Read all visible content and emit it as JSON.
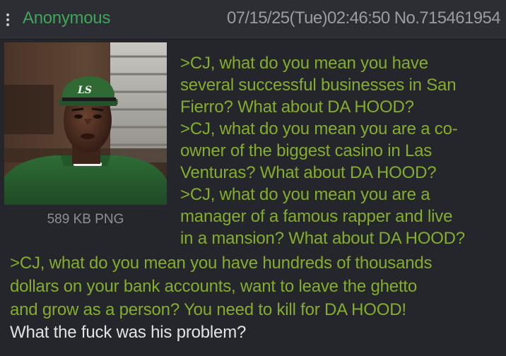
{
  "header": {
    "name": "Anonymous",
    "datetime": "07/15/25(Tue)02:46:50",
    "post_number": "No.715461954"
  },
  "file": {
    "info": "589 KB PNG",
    "cap_text": "LS"
  },
  "post": {
    "lines": [
      ">CJ, what do you mean you have",
      "several successful businesses in San",
      "Fierro? What about DA HOOD?",
      ">CJ, what do you mean you are a co-",
      "owner of the biggest casino in Las",
      "Venturas? What about DA HOOD?",
      ">CJ, what do you mean you are a",
      "manager of a famous rapper and live",
      "in a mansion? What about DA HOOD?",
      ">CJ, what do you mean you have hundreds of thousands",
      "dollars on your bank accounts, want to leave the ghetto",
      "and grow as a person? You need to kill for DA HOOD!",
      "What the fuck was his problem?"
    ]
  },
  "colors": {
    "background": "#25262b",
    "name": "#3fa55a",
    "greentext": "#84ad2c",
    "text": "#e3e3e3",
    "meta": "#9b9ca1"
  },
  "icons": {
    "menu": "vertical-dots-icon"
  }
}
